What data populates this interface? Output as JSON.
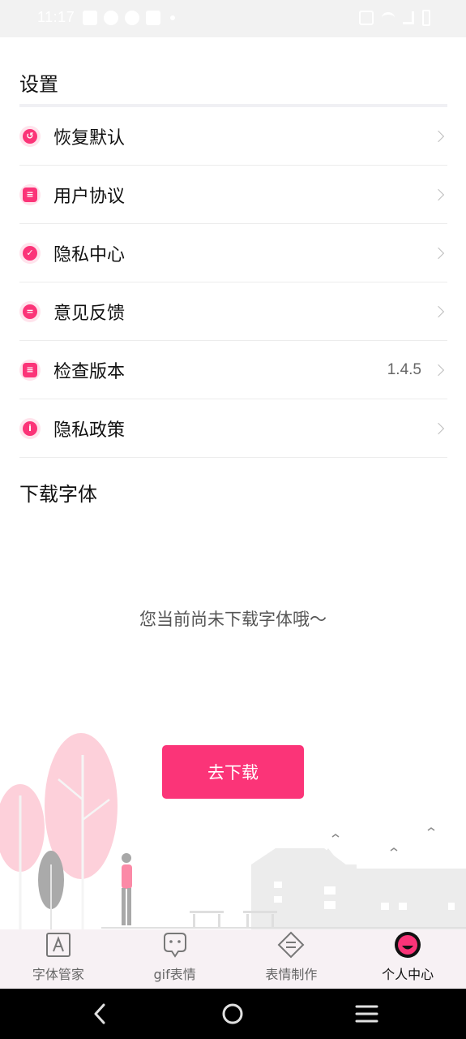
{
  "status_bar": {
    "time": "11:17"
  },
  "settings": {
    "title": "设置",
    "items": [
      {
        "label": "恢复默认",
        "icon": "restore-icon",
        "value": ""
      },
      {
        "label": "用户协议",
        "icon": "calendar-icon",
        "value": ""
      },
      {
        "label": "隐私中心",
        "icon": "shield-check-icon",
        "value": ""
      },
      {
        "label": "意见反馈",
        "icon": "feedback-icon",
        "value": ""
      },
      {
        "label": "检查版本",
        "icon": "document-icon",
        "value": "1.4.5"
      },
      {
        "label": "隐私政策",
        "icon": "info-icon",
        "value": ""
      }
    ]
  },
  "downloads": {
    "title": "下载字体",
    "empty_message": "您当前尚未下载字体哦～",
    "button_label": "去下载"
  },
  "tabs": [
    {
      "label": "字体管家",
      "icon": "font-a-icon",
      "active": false
    },
    {
      "label": "gif表情",
      "icon": "gif-face-icon",
      "active": false
    },
    {
      "label": "表情制作",
      "icon": "sticker-make-icon",
      "active": false
    },
    {
      "label": "个人中心",
      "icon": "profile-face-icon",
      "active": true
    }
  ],
  "colors": {
    "accent": "#fb3478",
    "accent_light": "#ffe3ec",
    "tab_bar_bg": "#f7f1f4"
  },
  "nav_bar": {
    "icons": [
      "back-icon",
      "home-icon",
      "recents-icon"
    ]
  }
}
